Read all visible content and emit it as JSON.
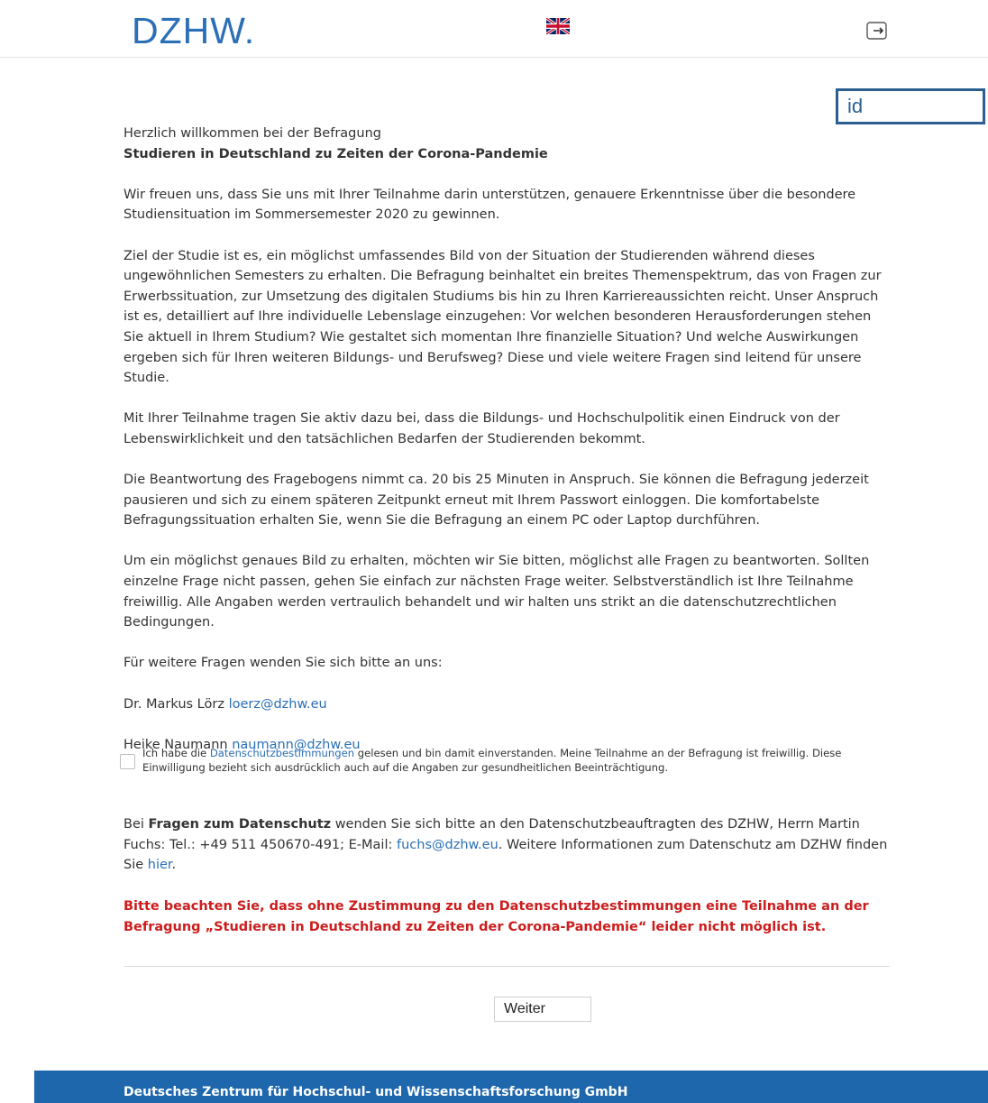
{
  "header": {
    "logo": "DZHW.",
    "language_flag_icon": "uk-flag-icon",
    "logout_icon": "logout-icon"
  },
  "id_field": {
    "value": "id"
  },
  "intro": {
    "greeting": "Herzlich willkommen bei der Befragung",
    "survey_title": "Studieren in Deutschland zu Zeiten der Corona-Pandemie"
  },
  "paragraphs": [
    "Wir freuen uns, dass Sie uns mit Ihrer Teilnahme darin unterstützen, genauere Erkenntnisse über die besondere Studiensituation im Sommersemester 2020 zu gewinnen.",
    "Ziel der Studie ist es, ein möglichst umfassendes Bild von der Situation der Studierenden während dieses ungewöhnlichen Semesters zu erhalten. Die Befragung beinhaltet ein breites Themenspektrum, das von Fragen zur Erwerbssituation, zur Umsetzung des digitalen Studiums bis hin zu Ihren Karriereaussichten reicht. Unser Anspruch ist es, detailliert auf Ihre individuelle Lebenslage einzugehen: Vor welchen besonderen Herausforderungen stehen Sie aktuell in Ihrem Studium? Wie gestaltet sich momentan Ihre finanzielle Situation? Und welche Auswirkungen ergeben sich für Ihren weiteren Bildungs- und Berufsweg? Diese und viele weitere Fragen sind leitend für unsere Studie.",
    "Mit Ihrer Teilnahme tragen Sie aktiv dazu bei, dass die Bildungs- und Hochschulpolitik einen Eindruck von der Lebenswirklichkeit und den tatsächlichen Bedarfen der Studierenden bekommt.",
    "Die Beantwortung des Fragebogens nimmt ca. 20 bis 25 Minuten in Anspruch. Sie können die Befragung jederzeit pausieren und sich zu einem späteren Zeitpunkt erneut mit Ihrem Passwort einloggen. Die komfortabelste Befragungssituation erhalten Sie, wenn Sie die Befragung an einem PC oder Laptop durchführen.",
    "Um ein möglichst genaues Bild zu erhalten, möchten wir Sie bitten, möglichst alle Fragen zu beantworten. Sollten einzelne Frage nicht passen, gehen Sie einfach zur nächsten Frage weiter. Selbstverständlich ist Ihre Teilnahme freiwillig. Alle Angaben werden vertraulich behandelt und wir halten uns strikt an die datenschutzrechtlichen Bedingungen.",
    "Für weitere Fragen wenden Sie sich bitte an uns:"
  ],
  "contacts": [
    {
      "name": "Dr. Markus Lörz",
      "email": "loerz@dzhw.eu"
    },
    {
      "name": "Heike Naumann",
      "email": "naumann@dzhw.eu"
    }
  ],
  "consent": {
    "checked": false,
    "text_before": "Ich habe die",
    "link": "Datenschutzbestimmungen",
    "text_after": "gelesen und bin damit einverstanden. Meine Teilnahme an der Befragung ist freiwillig. Diese Einwilligung bezieht sich ausdrücklich auch auf die Angaben zur gesundheitlichen Beeinträchtigung."
  },
  "privacy": {
    "prefix": "Bei",
    "bold": "Fragen zum Datenschutz",
    "middle": "wenden Sie sich bitte an den Datenschutzbeauftragten des DZHW, Herrn Martin Fuchs: Tel.: +49 511 450670-491; E-Mail:",
    "email": "fuchs@dzhw.eu",
    "after_email": ". Weitere Informationen zum Datenschutz am DZHW finden Sie",
    "link": "hier",
    "end": "."
  },
  "warning": "Bitte beachten Sie, dass ohne Zustimmung zu den Datenschutzbestimmungen eine Teilnahme an der Befragung „Studieren in Deutschland zu Zeiten der Corona-Pandemie“ leider nicht möglich ist.",
  "next_button": "Weiter",
  "footer": "Deutsches Zentrum für Hochschul- und Wissenschaftsforschung GmbH",
  "colors": {
    "brand": "#2b6fb6",
    "footer": "#1e67ad",
    "warning": "#cc1d1d",
    "id_border": "#2b5f91"
  }
}
